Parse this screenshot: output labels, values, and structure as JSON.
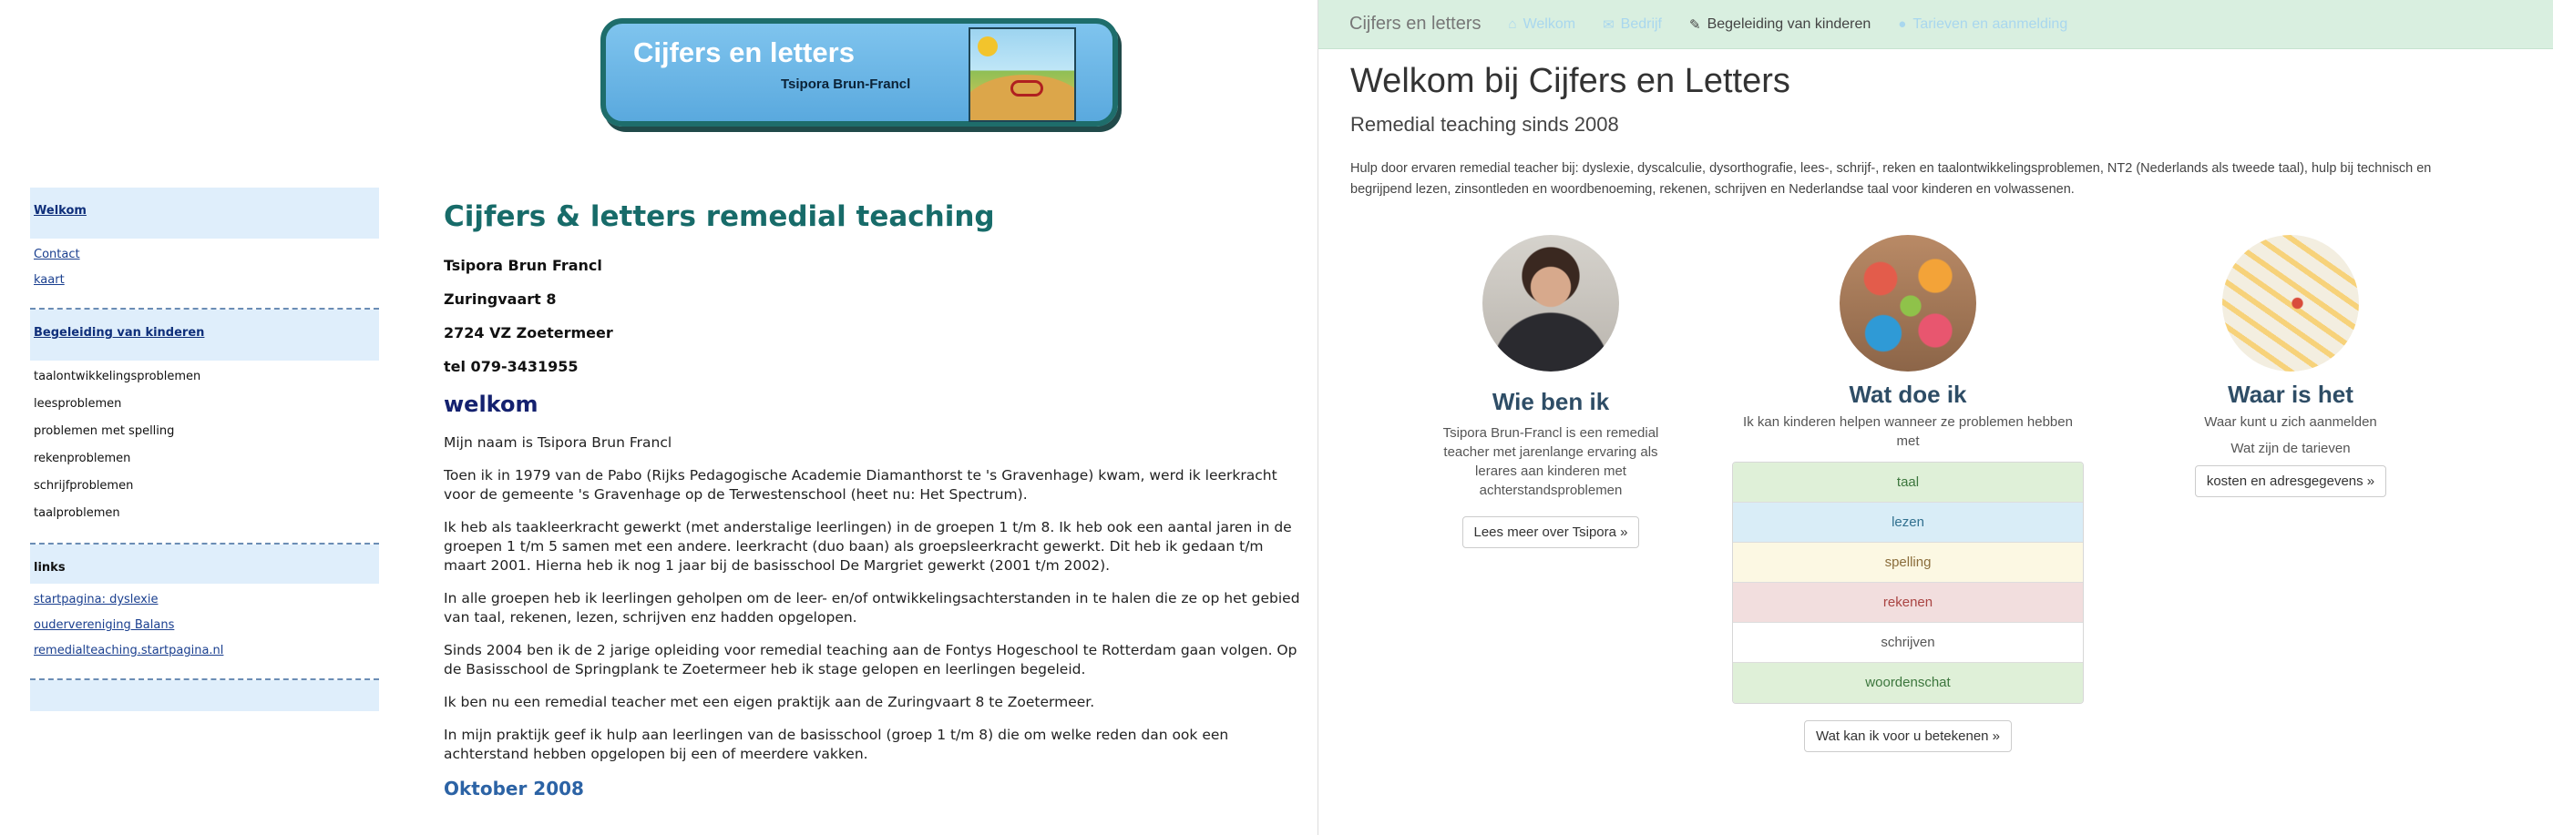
{
  "left_site": {
    "banner": {
      "title": "Cijfers en letters",
      "subtitle": "Tsipora Brun-Francl"
    },
    "sidebar": {
      "section1": [
        {
          "label": "Welkom",
          "bold": true
        },
        {
          "label": "Contact"
        },
        {
          "label": "kaart"
        }
      ],
      "section2_head": "Begeleiding van kinderen",
      "section2_items": [
        "taalontwikkelingsproblemen",
        "leesproblemen",
        "problemen met spelling",
        "rekenproblemen",
        "schrijfproblemen",
        "taalproblemen"
      ],
      "section3_head": "links",
      "section3_links": [
        "startpagina: dyslexie",
        "oudervereniging Balans",
        "remedialteaching.startpagina.nl"
      ]
    },
    "main": {
      "title": "Cijfers & letters remedial teaching",
      "address": [
        "Tsipora Brun Francl",
        "Zuringvaart 8",
        "2724 VZ Zoetermeer",
        "tel 079-3431955"
      ],
      "welcome_heading": "welkom",
      "paragraphs": [
        "Mijn naam is Tsipora Brun Francl",
        "Toen ik in 1979 van de Pabo (Rijks Pedagogische Academie Diamanthorst te 's Gravenhage) kwam, werd ik leerkracht voor de gemeente 's Gravenhage op de Terwestenschool (heet nu: Het Spectrum).",
        "Ik heb als taakleerkracht gewerkt (met anderstalige leerlingen) in de groepen 1 t/m 8. Ik heb ook een aantal jaren in de groepen 1 t/m 5 samen met een andere. leerkracht (duo baan) als groepsleerkracht gewerkt. Dit heb ik gedaan t/m maart 2001. Hierna heb ik nog 1 jaar bij de basisschool De Margriet gewerkt (2001 t/m 2002).",
        "In alle groepen heb ik leerlingen geholpen om de leer- en/of ontwikkelingsachterstanden in te halen die ze op het gebied van taal, rekenen, lezen, schrijven enz hadden opgelopen.",
        "Sinds 2004 ben ik de 2 jarige opleiding voor remedial teaching aan de Fontys Hogeschool te Rotterdam gaan volgen. Op de Basisschool de Springplank te Zoetermeer heb ik stage gelopen en leerlingen begeleid.",
        "Ik ben nu een remedial teacher met een eigen praktijk aan de Zuringvaart 8 te Zoetermeer.",
        "In mijn praktijk geef ik hulp aan leerlingen van de basisschool (groep 1 t/m 8) die om welke reden dan ook een achterstand hebben opgelopen bij een of meerdere vakken."
      ],
      "subheading": "Oktober 2008"
    }
  },
  "right_site": {
    "navbar": {
      "brand": "Cijfers en letters",
      "items": [
        {
          "label": "Welkom",
          "icon": "home-icon",
          "glyph": "⌂"
        },
        {
          "label": "Bedrijf",
          "icon": "bookmark-icon",
          "glyph": "✎"
        },
        {
          "label": "Begeleiding van kinderen",
          "icon": "pencil-icon",
          "glyph": "✎",
          "active": true
        },
        {
          "label": "Tarieven en aanmelding",
          "icon": "user-icon",
          "glyph": "👤"
        }
      ]
    },
    "hero": {
      "title": "Welkom bij Cijfers en Letters",
      "subtitle": "Remedial teaching sinds 2008",
      "text": "Hulp door ervaren remedial teacher bij: dyslexie, dyscalculie, dysorthografie, lees-, schrijf-, reken en taalontwikkelingsproblemen, NT2 (Nederlands als tweede taal), hulp bij technisch en begrijpend lezen, zinsontleden en woordbenoeming, rekenen, schrijven en Nederlandse taal voor kinderen en volwassenen."
    },
    "columns": {
      "who": {
        "heading": "Wie ben ik",
        "text": "Tsipora Brun-Francl is een remedial teacher met jarenlange ervaring als lerares aan kinderen met achterstandsproblemen",
        "button": "Lees meer over Tsipora »"
      },
      "what": {
        "heading": "Wat doe ik",
        "text": "Ik kan kinderen helpen wanneer ze problemen hebben met",
        "list": [
          "taal",
          "lezen",
          "spelling",
          "rekenen",
          "schrijven",
          "woordenschat"
        ],
        "button": "Wat kan ik voor u betekenen »"
      },
      "where": {
        "heading": "Waar is het",
        "text": "Waar kunt u zich aanmelden",
        "text2": "Wat zijn de tarieven",
        "button": "kosten en adresgegevens »"
      }
    }
  }
}
